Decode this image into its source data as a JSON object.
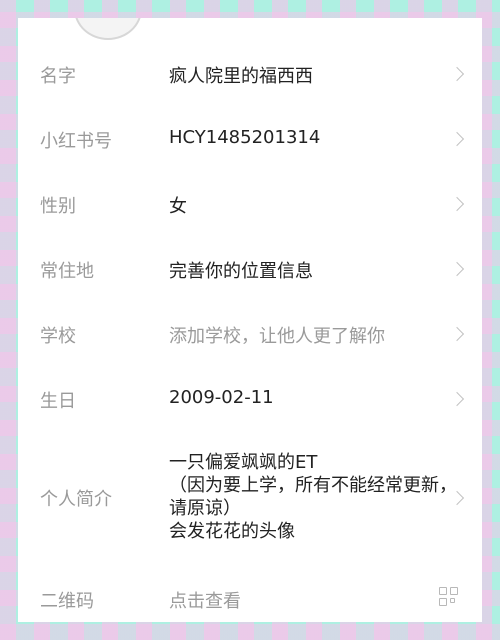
{
  "profile_fields": [
    {
      "label": "名字",
      "value": "疯人院里的福西西",
      "placeholder": false
    },
    {
      "label": "小红书号",
      "value": "HCY1485201314",
      "placeholder": false
    },
    {
      "label": "性别",
      "value": "女",
      "placeholder": false
    },
    {
      "label": "常住地",
      "value": "完善你的位置信息",
      "placeholder": false
    },
    {
      "label": "学校",
      "value": "添加学校，让他人更了解你",
      "placeholder": true
    },
    {
      "label": "生日",
      "value": "2009-02-11",
      "placeholder": false
    },
    {
      "label": "个人简介",
      "value_lines": [
        "一只偏爱飒飒的ET",
        "（因为要上学，所有不能经常更新，请原谅）",
        "会发花花的头像"
      ]
    },
    {
      "label": "二维码",
      "value": "点击查看",
      "placeholder": true,
      "icon": "qr-code-icon"
    }
  ],
  "colors": {
    "label": "#9a9a9a",
    "value": "#222222",
    "background_teal": "#aef0e2",
    "background_pink": "#ffbeeb"
  }
}
